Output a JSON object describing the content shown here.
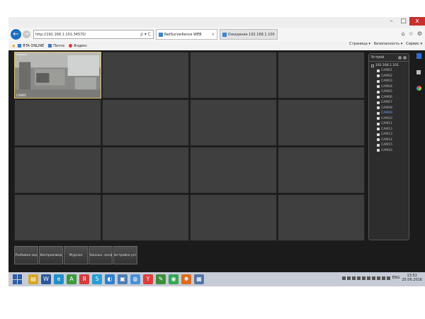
{
  "window": {
    "controls": {
      "minimize": "–",
      "maximize": "□",
      "close": "x"
    }
  },
  "nav": {
    "address": "http://192.168.1.101:34570/",
    "address_tools": "ρ ▾ C",
    "tabs": [
      {
        "label": "NetSurveillance WEB",
        "close": "×",
        "active": true
      },
      {
        "label": "Ожидание 192.168.1.100",
        "active": false
      }
    ],
    "right_icons": [
      "home-icon",
      "star-icon",
      "gear-icon"
    ]
  },
  "favorites": {
    "items": [
      {
        "label": "BTA ONLINE"
      },
      {
        "label": "Почта"
      },
      {
        "label": "Яндекс"
      }
    ],
    "commands": [
      "Страница ▾",
      "Безопасность ▾",
      "Сервис ▾"
    ]
  },
  "app": {
    "grid": {
      "rows": 4,
      "cols": 4
    },
    "selected_camera_label": "CAM05",
    "selected_camera_top_text": "00000000",
    "device_panel": {
      "title": "Устрой",
      "root": "192.168.1.101",
      "cameras": [
        "CAM01",
        "CAM02",
        "CAM03",
        "CAM04",
        "CAM05",
        "CAM06",
        "CAM07",
        "CAM08",
        "CAM09",
        "CAM10",
        "CAM11",
        "CAM12",
        "CAM13",
        "CAM14",
        "CAM15",
        "CAM16"
      ],
      "active_camera": "CAM09"
    },
    "bottom_buttons": [
      "Разбивка экр",
      "Воспроизвед",
      "Журнал",
      "Локальн. конф",
      "Настройка устр"
    ]
  },
  "taskbar": {
    "apps": [
      {
        "name": "file-explorer-icon",
        "glyph": "▤",
        "color": "#d9a623"
      },
      {
        "name": "word-icon",
        "glyph": "W",
        "color": "#2b579a"
      },
      {
        "name": "internet-explorer-icon",
        "glyph": "e",
        "color": "#1e90c8"
      },
      {
        "name": "android-icon",
        "glyph": "A",
        "color": "#3c9a3c"
      },
      {
        "name": "yandex-icon",
        "glyph": "Я",
        "color": "#d63b3b"
      },
      {
        "name": "skype-icon",
        "glyph": "S",
        "color": "#25a0d6"
      },
      {
        "name": "media-player-icon",
        "glyph": "◐",
        "color": "#2f7fd1"
      },
      {
        "name": "network-icon",
        "glyph": "▣",
        "color": "#4a7db5"
      },
      {
        "name": "globe-icon",
        "glyph": "◍",
        "color": "#4a90d9"
      },
      {
        "name": "yandex-browser-icon",
        "glyph": "Y",
        "color": "#e23c3c"
      },
      {
        "name": "paint-icon",
        "glyph": "✎",
        "color": "#3c8f3c"
      },
      {
        "name": "chrome-icon",
        "glyph": "◉",
        "color": "#32a852"
      },
      {
        "name": "firefox-icon",
        "glyph": "✺",
        "color": "#e06a1b"
      },
      {
        "name": "printer-icon",
        "glyph": "▦",
        "color": "#5077a8"
      }
    ],
    "lang": "ENG",
    "time": "13:52",
    "date": "25.06.2016"
  }
}
